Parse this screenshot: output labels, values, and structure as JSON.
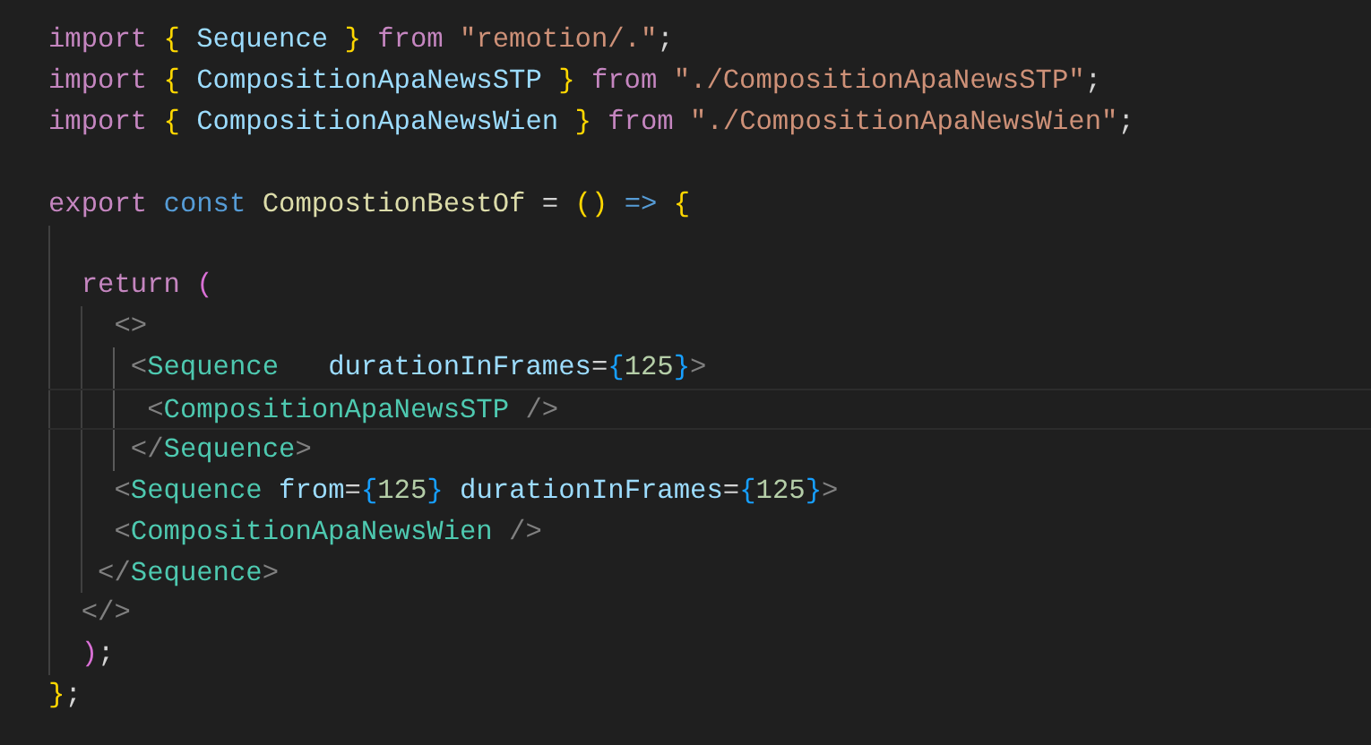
{
  "editor": {
    "lines": [
      {
        "current": false,
        "tokens": [
          {
            "kind": "keyword",
            "text": "import "
          },
          {
            "kind": "brace1",
            "text": "{ "
          },
          {
            "kind": "variable",
            "text": "Sequence "
          },
          {
            "kind": "brace1",
            "text": "} "
          },
          {
            "kind": "keyword",
            "text": "from "
          },
          {
            "kind": "string",
            "text": "\"remotion/.\""
          },
          {
            "kind": "plain",
            "text": ";"
          }
        ]
      },
      {
        "current": false,
        "tokens": [
          {
            "kind": "keyword",
            "text": "import "
          },
          {
            "kind": "brace1",
            "text": "{ "
          },
          {
            "kind": "variable",
            "text": "CompositionApaNewsSTP "
          },
          {
            "kind": "brace1",
            "text": "} "
          },
          {
            "kind": "keyword",
            "text": "from "
          },
          {
            "kind": "string",
            "text": "\"./CompositionApaNewsSTP\""
          },
          {
            "kind": "plain",
            "text": ";"
          }
        ]
      },
      {
        "current": false,
        "tokens": [
          {
            "kind": "keyword",
            "text": "import "
          },
          {
            "kind": "brace1",
            "text": "{ "
          },
          {
            "kind": "variable",
            "text": "CompositionApaNewsWien "
          },
          {
            "kind": "brace1",
            "text": "} "
          },
          {
            "kind": "keyword",
            "text": "from "
          },
          {
            "kind": "string",
            "text": "\"./CompositionApaNewsWien\""
          },
          {
            "kind": "plain",
            "text": ";"
          }
        ]
      },
      {
        "current": false
      },
      {
        "current": false,
        "tokens": [
          {
            "kind": "keyword",
            "text": "export "
          },
          {
            "kind": "storage",
            "text": "const "
          },
          {
            "kind": "function",
            "text": "CompostionBestOf "
          },
          {
            "kind": "plain",
            "text": "= "
          },
          {
            "kind": "brace1",
            "text": "() "
          },
          {
            "kind": "storage",
            "text": "=> "
          },
          {
            "kind": "brace1",
            "text": "{"
          }
        ]
      },
      {
        "current": false
      },
      {
        "current": false,
        "tokens": [
          {
            "kind": "keyword",
            "text": "  return "
          },
          {
            "kind": "brace2",
            "text": "("
          }
        ]
      },
      {
        "current": false,
        "tokens": [
          {
            "kind": "bracket",
            "text": "    <>"
          }
        ]
      },
      {
        "current": false,
        "tokens": [
          {
            "kind": "bracket",
            "text": "     <"
          },
          {
            "kind": "tag",
            "text": "Sequence   "
          },
          {
            "kind": "attr",
            "text": "durationInFrames"
          },
          {
            "kind": "plain",
            "text": "="
          },
          {
            "kind": "brace3",
            "text": "{"
          },
          {
            "kind": "number",
            "text": "125"
          },
          {
            "kind": "brace3",
            "text": "}"
          },
          {
            "kind": "bracket",
            "text": ">"
          }
        ]
      },
      {
        "current": true,
        "tokens": [
          {
            "kind": "bracket",
            "text": "      <"
          },
          {
            "kind": "tag",
            "text": "CompositionApaNewsSTP "
          },
          {
            "kind": "bracket",
            "text": "/>"
          }
        ]
      },
      {
        "current": false,
        "tokens": [
          {
            "kind": "bracket",
            "text": "     </"
          },
          {
            "kind": "tag",
            "text": "Sequence"
          },
          {
            "kind": "bracket",
            "text": ">"
          }
        ]
      },
      {
        "current": false,
        "tokens": [
          {
            "kind": "bracket",
            "text": "    <"
          },
          {
            "kind": "tag",
            "text": "Sequence "
          },
          {
            "kind": "attr",
            "text": "from"
          },
          {
            "kind": "plain",
            "text": "="
          },
          {
            "kind": "brace3",
            "text": "{"
          },
          {
            "kind": "number",
            "text": "125"
          },
          {
            "kind": "brace3",
            "text": "} "
          },
          {
            "kind": "attr",
            "text": "durationInFrames"
          },
          {
            "kind": "plain",
            "text": "="
          },
          {
            "kind": "brace3",
            "text": "{"
          },
          {
            "kind": "number",
            "text": "125"
          },
          {
            "kind": "brace3",
            "text": "}"
          },
          {
            "kind": "bracket",
            "text": ">"
          }
        ]
      },
      {
        "current": false,
        "tokens": [
          {
            "kind": "bracket",
            "text": "    <"
          },
          {
            "kind": "tag",
            "text": "CompositionApaNewsWien "
          },
          {
            "kind": "bracket",
            "text": "/>"
          }
        ]
      },
      {
        "current": false,
        "tokens": [
          {
            "kind": "bracket",
            "text": "   </"
          },
          {
            "kind": "tag",
            "text": "Sequence"
          },
          {
            "kind": "bracket",
            "text": ">"
          }
        ]
      },
      {
        "current": false,
        "tokens": [
          {
            "kind": "bracket",
            "text": "  </>"
          }
        ]
      },
      {
        "current": false,
        "tokens": [
          {
            "kind": "brace2",
            "text": "  )"
          },
          {
            "kind": "plain",
            "text": ";"
          }
        ]
      },
      {
        "current": false,
        "tokens": [
          {
            "kind": "brace1",
            "text": "}"
          },
          {
            "kind": "plain",
            "text": ";"
          }
        ]
      }
    ]
  }
}
